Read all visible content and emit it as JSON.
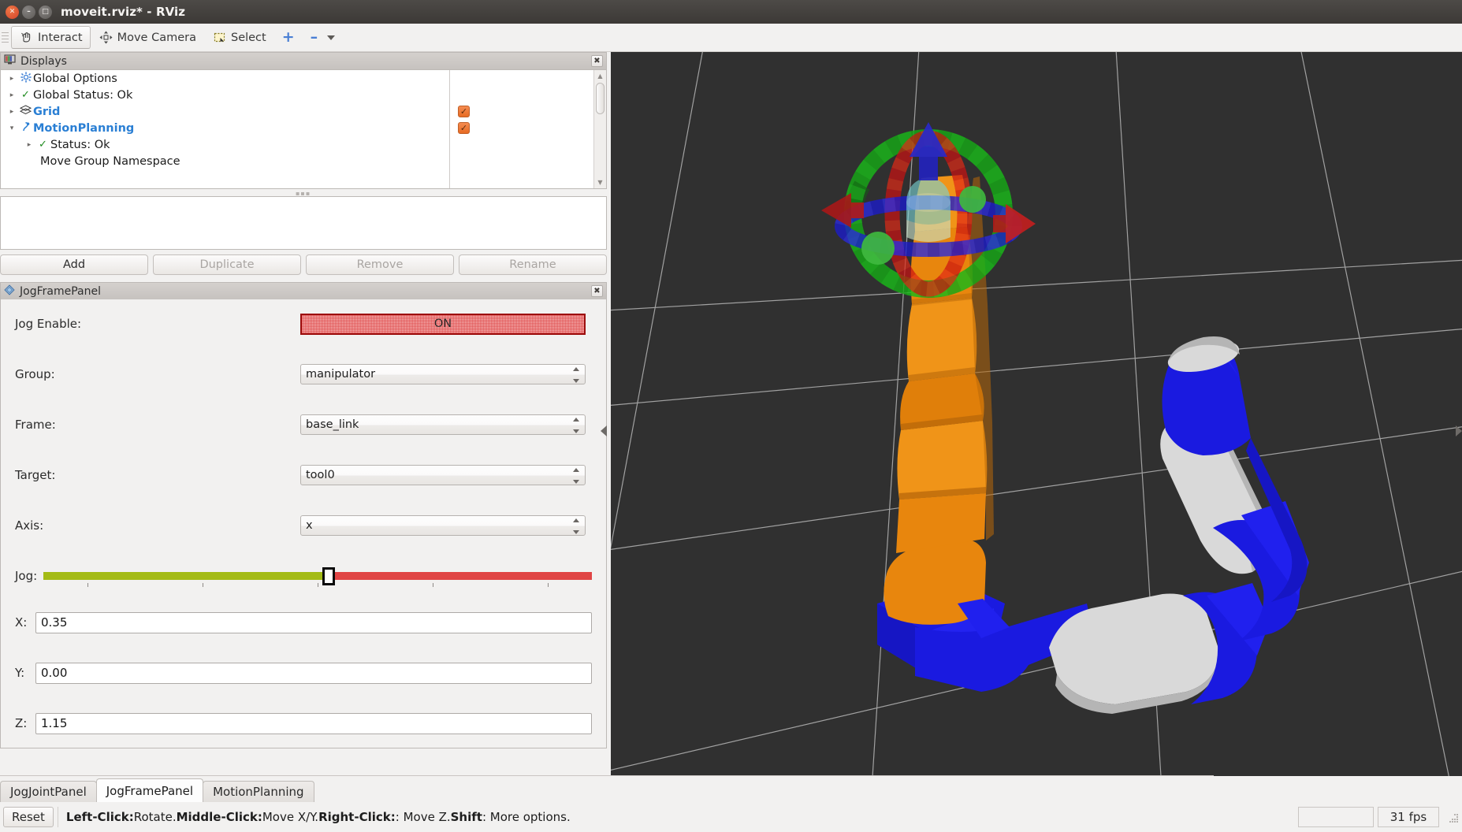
{
  "window": {
    "title": "moveit.rviz* - RViz",
    "close_icon": "window-close-icon",
    "minimize_icon": "window-minimize-icon",
    "maximize_icon": "window-maximize-icon"
  },
  "toolbar": {
    "items": [
      {
        "label": "Interact",
        "icon": "hand-pointer-icon",
        "active": true
      },
      {
        "label": "Move Camera",
        "icon": "move-camera-icon",
        "active": false
      },
      {
        "label": "Select",
        "icon": "select-rectangle-icon",
        "active": false
      }
    ],
    "plus_label": "+",
    "minus_label": "–",
    "plus_icon": "focus-camera-icon",
    "minus_icon": "measure-icon",
    "overflow_icon": "chevron-down-icon"
  },
  "displays": {
    "title": "Displays",
    "title_icon": "display-monitor-icon",
    "close_icon": "close-icon",
    "tree": [
      {
        "label": "Global Options",
        "icon": "gear-icon",
        "expander": "▸",
        "indent": 0,
        "bold": false,
        "checkbox": null
      },
      {
        "label": "Global Status: Ok",
        "icon": "check-icon",
        "expander": "▸",
        "indent": 0,
        "bold": false,
        "checkbox": null
      },
      {
        "label": "Grid",
        "icon": "grid-icon",
        "expander": "▸",
        "indent": 0,
        "bold": true,
        "checkbox": true
      },
      {
        "label": "MotionPlanning",
        "icon": "motion-planning-icon",
        "expander": "▾",
        "indent": 0,
        "bold": true,
        "checkbox": true
      },
      {
        "label": "Status: Ok",
        "icon": "check-icon",
        "expander": "▸",
        "indent": 1,
        "bold": false,
        "checkbox": null
      },
      {
        "label": "Move Group Namespace",
        "icon": "",
        "expander": "",
        "indent": 1,
        "bold": false,
        "checkbox": null
      }
    ],
    "buttons": [
      {
        "label": "Add",
        "enabled": true
      },
      {
        "label": "Duplicate",
        "enabled": false
      },
      {
        "label": "Remove",
        "enabled": false
      },
      {
        "label": "Rename",
        "enabled": false
      }
    ]
  },
  "jog_frame_panel": {
    "title": "JogFramePanel",
    "title_icon": "panel-diamond-icon",
    "close_icon": "close-icon",
    "jog_enable": {
      "label": "Jog Enable:",
      "value": "ON"
    },
    "group": {
      "label": "Group:",
      "value": "manipulator"
    },
    "frame": {
      "label": "Frame:",
      "value": "base_link"
    },
    "target": {
      "label": "Target:",
      "value": "tool0"
    },
    "axis": {
      "label": "Axis:",
      "value": "x"
    },
    "jog_slider": {
      "label": "Jog:",
      "position_percent": 52,
      "min": 0,
      "max": 100,
      "tick_count": 5
    },
    "coords": [
      {
        "label": "X:",
        "value": "0.35"
      },
      {
        "label": "Y:",
        "value": "0.00"
      },
      {
        "label": "Z:",
        "value": "1.15"
      }
    ]
  },
  "bottom_tabs": [
    {
      "label": "JogJointPanel",
      "selected": false
    },
    {
      "label": "JogFramePanel",
      "selected": true
    },
    {
      "label": "MotionPlanning",
      "selected": false
    }
  ],
  "status_bar": {
    "reset_label": "Reset",
    "hint_parts": [
      {
        "text": "Left-Click:",
        "bold": true
      },
      {
        "text": " Rotate. ",
        "bold": false
      },
      {
        "text": "Middle-Click:",
        "bold": true
      },
      {
        "text": " Move X/Y. ",
        "bold": false
      },
      {
        "text": "Right-Click:",
        "bold": true
      },
      {
        "text": ": Move Z. ",
        "bold": false
      },
      {
        "text": "Shift",
        "bold": true
      },
      {
        "text": ": More options.",
        "bold": false
      }
    ],
    "fps": "31 fps"
  },
  "viewport": {
    "background_color": "#303030",
    "grid_color": "#b5b5b5",
    "robot": {
      "link_colors": {
        "orange": "#e8860d",
        "blue": "#1a1ae0",
        "white": "#d9d9d9",
        "gray": "#b5b5b5"
      }
    },
    "interactive_marker": {
      "ring_colors": {
        "x_red": "#cc1111",
        "y_green": "#16a816",
        "z_blue": "#1b1bcc"
      },
      "arrow_colors": {
        "x_red": "#b11a1a",
        "z_blue": "#2222bb"
      },
      "sphere_color": "#3fb83f",
      "ghost_color": "#7ad4d4"
    }
  },
  "collapse_handles": {
    "left_icon": "collapse-left-icon",
    "right_icon": "collapse-right-icon"
  }
}
